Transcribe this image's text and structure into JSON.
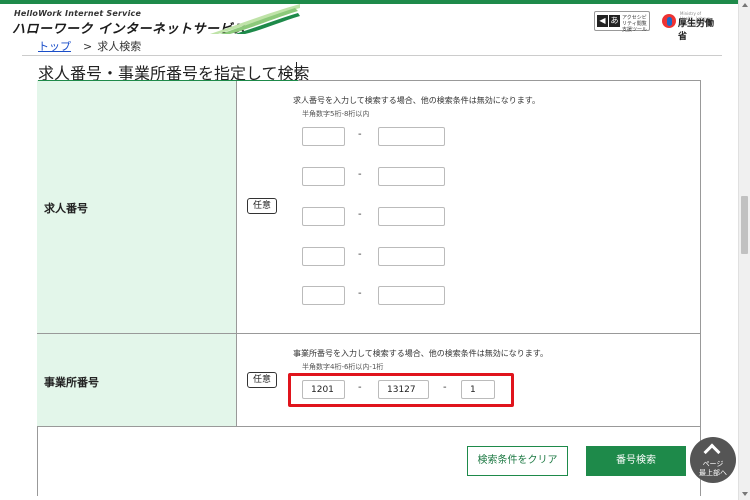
{
  "header": {
    "logo_sub": "HelloWork Internet Service",
    "logo_main": "ハローワーク インターネットサービス",
    "accessibility_badge": "アクセシビリティ閲覧支援ツール",
    "ministry": "厚生労働省",
    "ministry_sub": "Ministry of Health, Labour and Welfare"
  },
  "breadcrumb": {
    "home": "トップ",
    "separator": ">",
    "current": "求人検索"
  },
  "page_title": "求人番号・事業所番号を指定して検索",
  "job_number": {
    "label": "求人番号",
    "optional_badge": "任意",
    "note": "求人番号を入力して検索する場合、他の検索条件は無効になります。",
    "format": "半角数字5桁-8桁以内",
    "dash": "-",
    "rows": [
      {
        "part1": "",
        "part2": ""
      },
      {
        "part1": "",
        "part2": ""
      },
      {
        "part1": "",
        "part2": ""
      },
      {
        "part1": "",
        "part2": ""
      },
      {
        "part1": "",
        "part2": ""
      }
    ]
  },
  "office_number": {
    "label": "事業所番号",
    "optional_badge": "任意",
    "note": "事業所番号を入力して検索する場合、他の検索条件は無効になります。",
    "format": "半角数字4桁-6桁以内-1桁",
    "dash": "-",
    "part1": "1201",
    "part2": "13127",
    "part3": "1"
  },
  "buttons": {
    "clear": "検索条件をクリア",
    "search": "番号検索"
  },
  "scroll_top": {
    "line1": "ページ",
    "line2": "最上部へ"
  },
  "colors": {
    "brand_green": "#1e8a4a",
    "label_bg": "#e3f6ea",
    "highlight_red": "#e0141c"
  }
}
